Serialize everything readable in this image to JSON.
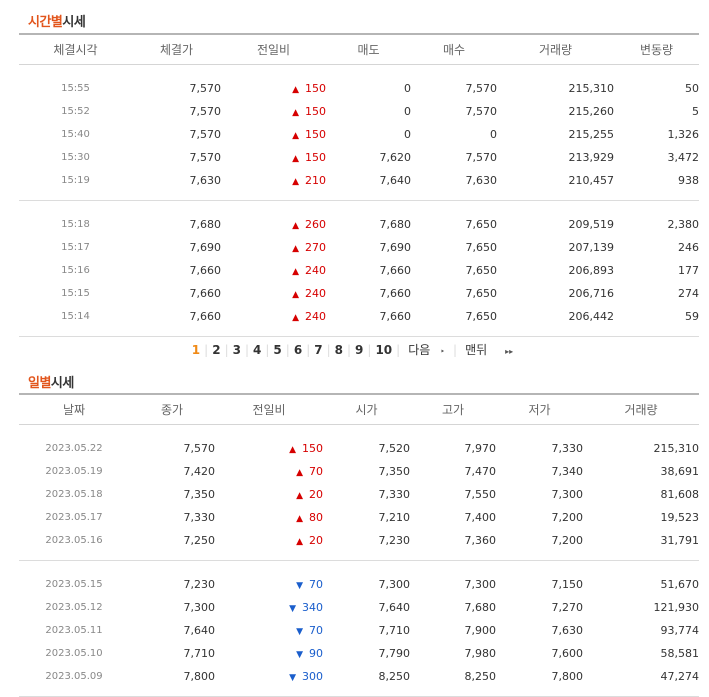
{
  "time_section": {
    "title_highlight": "시간별",
    "title_rest": "시세",
    "headers": [
      "체결시각",
      "체결가",
      "전일비",
      "매도",
      "매수",
      "거래량",
      "변동량"
    ],
    "groups": [
      [
        {
          "time": "15:55",
          "price": "7,570",
          "dir": "up",
          "arrow": "▲",
          "change": "150",
          "sell": "0",
          "buy": "7,570",
          "volume": "215,310",
          "delta": "50"
        },
        {
          "time": "15:52",
          "price": "7,570",
          "dir": "up",
          "arrow": "▲",
          "change": "150",
          "sell": "0",
          "buy": "7,570",
          "volume": "215,260",
          "delta": "5"
        },
        {
          "time": "15:40",
          "price": "7,570",
          "dir": "up",
          "arrow": "▲",
          "change": "150",
          "sell": "0",
          "buy": "0",
          "volume": "215,255",
          "delta": "1,326"
        },
        {
          "time": "15:30",
          "price": "7,570",
          "dir": "up",
          "arrow": "▲",
          "change": "150",
          "sell": "7,620",
          "buy": "7,570",
          "volume": "213,929",
          "delta": "3,472"
        },
        {
          "time": "15:19",
          "price": "7,630",
          "dir": "up",
          "arrow": "▲",
          "change": "210",
          "sell": "7,640",
          "buy": "7,630",
          "volume": "210,457",
          "delta": "938"
        }
      ],
      [
        {
          "time": "15:18",
          "price": "7,680",
          "dir": "up",
          "arrow": "▲",
          "change": "260",
          "sell": "7,680",
          "buy": "7,650",
          "volume": "209,519",
          "delta": "2,380"
        },
        {
          "time": "15:17",
          "price": "7,690",
          "dir": "up",
          "arrow": "▲",
          "change": "270",
          "sell": "7,690",
          "buy": "7,650",
          "volume": "207,139",
          "delta": "246"
        },
        {
          "time": "15:16",
          "price": "7,660",
          "dir": "up",
          "arrow": "▲",
          "change": "240",
          "sell": "7,660",
          "buy": "7,650",
          "volume": "206,893",
          "delta": "177"
        },
        {
          "time": "15:15",
          "price": "7,660",
          "dir": "up",
          "arrow": "▲",
          "change": "240",
          "sell": "7,660",
          "buy": "7,650",
          "volume": "206,716",
          "delta": "274"
        },
        {
          "time": "15:14",
          "price": "7,660",
          "dir": "up",
          "arrow": "▲",
          "change": "240",
          "sell": "7,660",
          "buy": "7,650",
          "volume": "206,442",
          "delta": "59"
        }
      ]
    ]
  },
  "pagination": {
    "pages": [
      "1",
      "2",
      "3",
      "4",
      "5",
      "6",
      "7",
      "8",
      "9",
      "10"
    ],
    "current": "1",
    "next_label": "다음",
    "next_arrow": "‣",
    "last_label": "맨뒤",
    "last_arrow": "▸▸"
  },
  "daily_section": {
    "title_highlight": "일별",
    "title_rest": "시세",
    "headers": [
      "날짜",
      "종가",
      "전일비",
      "시가",
      "고가",
      "저가",
      "거래량"
    ],
    "groups": [
      [
        {
          "date": "2023.05.22",
          "close": "7,570",
          "dir": "up",
          "arrow": "▲",
          "change": "150",
          "open": "7,520",
          "high": "7,970",
          "low": "7,330",
          "volume": "215,310"
        },
        {
          "date": "2023.05.19",
          "close": "7,420",
          "dir": "up",
          "arrow": "▲",
          "change": "70",
          "open": "7,350",
          "high": "7,470",
          "low": "7,340",
          "volume": "38,691"
        },
        {
          "date": "2023.05.18",
          "close": "7,350",
          "dir": "up",
          "arrow": "▲",
          "change": "20",
          "open": "7,330",
          "high": "7,550",
          "low": "7,300",
          "volume": "81,608"
        },
        {
          "date": "2023.05.17",
          "close": "7,330",
          "dir": "up",
          "arrow": "▲",
          "change": "80",
          "open": "7,210",
          "high": "7,400",
          "low": "7,200",
          "volume": "19,523"
        },
        {
          "date": "2023.05.16",
          "close": "7,250",
          "dir": "up",
          "arrow": "▲",
          "change": "20",
          "open": "7,230",
          "high": "7,360",
          "low": "7,200",
          "volume": "31,791"
        }
      ],
      [
        {
          "date": "2023.05.15",
          "close": "7,230",
          "dir": "down",
          "arrow": "▼",
          "change": "70",
          "open": "7,300",
          "high": "7,300",
          "low": "7,150",
          "volume": "51,670"
        },
        {
          "date": "2023.05.12",
          "close": "7,300",
          "dir": "down",
          "arrow": "▼",
          "change": "340",
          "open": "7,640",
          "high": "7,680",
          "low": "7,270",
          "volume": "121,930"
        },
        {
          "date": "2023.05.11",
          "close": "7,640",
          "dir": "down",
          "arrow": "▼",
          "change": "70",
          "open": "7,710",
          "high": "7,900",
          "low": "7,630",
          "volume": "93,774"
        },
        {
          "date": "2023.05.10",
          "close": "7,710",
          "dir": "down",
          "arrow": "▼",
          "change": "90",
          "open": "7,790",
          "high": "7,980",
          "low": "7,600",
          "volume": "58,581"
        },
        {
          "date": "2023.05.09",
          "close": "7,800",
          "dir": "down",
          "arrow": "▼",
          "change": "300",
          "open": "8,250",
          "high": "8,250",
          "low": "7,800",
          "volume": "47,274"
        }
      ]
    ]
  },
  "colors": {
    "accent": "#e2551c",
    "up": "#d60000",
    "down": "#1a5ecc",
    "page_current": "#f08a16"
  }
}
